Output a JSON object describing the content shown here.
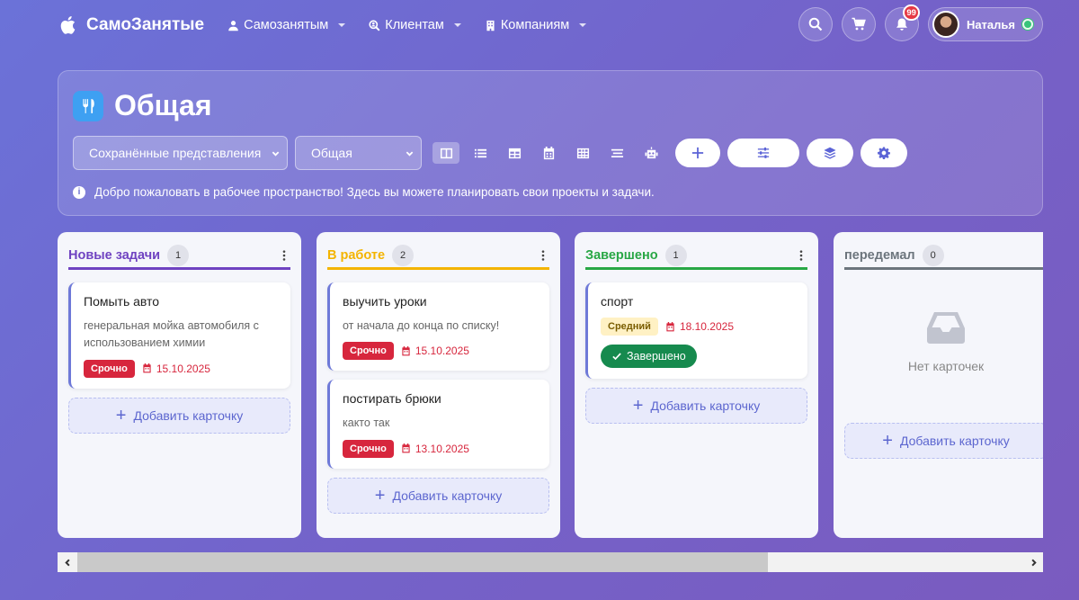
{
  "nav": {
    "brand": "СамоЗанятые",
    "menus": [
      {
        "label": "Самозанятым",
        "icon": "user-icon"
      },
      {
        "label": "Клиентам",
        "icon": "search-user-icon"
      },
      {
        "label": "Компаниям",
        "icon": "building-icon"
      }
    ],
    "notifications_count": "99",
    "user_name": "Наталья"
  },
  "header": {
    "title": "Общая",
    "saved_views_label": "Сохранённые представления",
    "current_view": "Общая",
    "info_text": "Добро пожаловать в рабочее пространство! Здесь вы можете планировать свои проекты и задачи."
  },
  "board": {
    "add_card_label": "Добавить карточку",
    "empty_label": "Нет карточек",
    "columns": [
      {
        "title": "Новые задачи",
        "count": "1",
        "color": "#6f42c1",
        "cards": [
          {
            "title": "Помыть авто",
            "desc": "генеральная мойка автомобиля с использованием химии",
            "priority": "Срочно",
            "due": "15.10.2025"
          }
        ]
      },
      {
        "title": "В работе",
        "count": "2",
        "color": "#f4b400",
        "cards": [
          {
            "title": "выучить уроки",
            "desc": "от начала до конца по списку!",
            "priority": "Срочно",
            "due": "15.10.2025"
          },
          {
            "title": "постирать брюки",
            "desc": "както так",
            "priority": "Срочно",
            "due": "13.10.2025"
          }
        ]
      },
      {
        "title": "Завершено",
        "count": "1",
        "color": "#28a745",
        "cards": [
          {
            "title": "спорт",
            "priority": "Средний",
            "due": "18.10.2025",
            "status": "Завершено"
          }
        ]
      },
      {
        "title": "передемал",
        "count": "0",
        "color": "#6c757d",
        "cards": []
      }
    ]
  }
}
